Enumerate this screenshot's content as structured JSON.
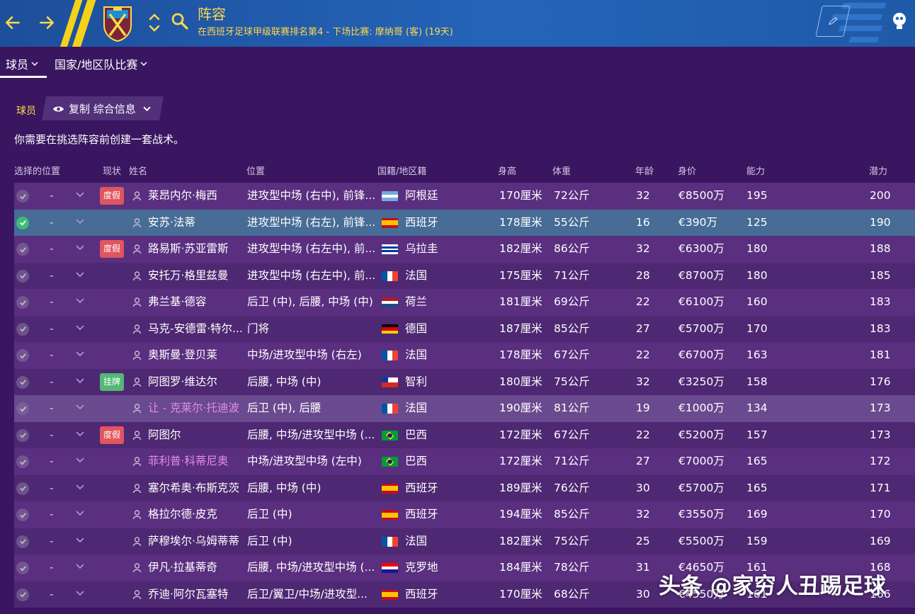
{
  "header": {
    "title": "阵容",
    "subtitle": "在西班牙足球甲级联赛排名第4 - 下场比赛: 摩纳哥 (客) (19天)"
  },
  "tabs": [
    {
      "label": "球员"
    },
    {
      "label": "国家/地区队比赛"
    }
  ],
  "toolbar": {
    "players_label": "球员",
    "view_label": "复制 综合信息"
  },
  "notice": "你需要在挑选阵容前创建一套战术。",
  "columns": {
    "selection": "选择的位置",
    "status": "现状",
    "name": "姓名",
    "position": "位置",
    "nationality": "国籍/地区籍",
    "height": "身高",
    "weight": "体重",
    "age": "年龄",
    "value": "身价",
    "ability": "能力",
    "potential": "潜力"
  },
  "rows": [
    {
      "selected": false,
      "sel_pos": "-",
      "status": "度假",
      "status_type": "inj",
      "name": "莱昂内尔·梅西",
      "position": "进攻型中场 (右中), 前锋...",
      "flag": "ar",
      "nation": "阿根廷",
      "height": "170厘米",
      "weight": "72公斤",
      "age": "32",
      "value": "€8500万",
      "ability": "195",
      "potential": "200",
      "style": "odd"
    },
    {
      "selected": true,
      "sel_pos": "-",
      "status": "",
      "status_type": "",
      "name": "安苏·法蒂",
      "position": "进攻型中场 (右左), 前锋...",
      "flag": "es",
      "nation": "西班牙",
      "height": "178厘米",
      "weight": "55公斤",
      "age": "16",
      "value": "€390万",
      "ability": "125",
      "potential": "190",
      "style": "sel"
    },
    {
      "selected": false,
      "sel_pos": "-",
      "status": "度假",
      "status_type": "inj",
      "name": "路易斯·苏亚雷斯",
      "position": "进攻型中场 (右左中), 前...",
      "flag": "uy",
      "nation": "乌拉圭",
      "height": "182厘米",
      "weight": "86公斤",
      "age": "32",
      "value": "€6300万",
      "ability": "180",
      "potential": "188",
      "style": "odd"
    },
    {
      "selected": false,
      "sel_pos": "-",
      "status": "",
      "status_type": "",
      "name": "安托万·格里兹曼",
      "position": "进攻型中场 (右左中), 前...",
      "flag": "fr",
      "nation": "法国",
      "height": "175厘米",
      "weight": "71公斤",
      "age": "28",
      "value": "€8700万",
      "ability": "180",
      "potential": "185",
      "style": "even"
    },
    {
      "selected": false,
      "sel_pos": "-",
      "status": "",
      "status_type": "",
      "name": "弗兰基·德容",
      "position": "后卫 (中), 后腰, 中场 (中)",
      "flag": "nl",
      "nation": "荷兰",
      "height": "181厘米",
      "weight": "69公斤",
      "age": "22",
      "value": "€6100万",
      "ability": "160",
      "potential": "183",
      "style": "odd"
    },
    {
      "selected": false,
      "sel_pos": "-",
      "status": "",
      "status_type": "",
      "name": "马克-安德雷·特尔...",
      "position": "门将",
      "flag": "de",
      "nation": "德国",
      "height": "187厘米",
      "weight": "85公斤",
      "age": "27",
      "value": "€5700万",
      "ability": "170",
      "potential": "183",
      "style": "even"
    },
    {
      "selected": false,
      "sel_pos": "-",
      "status": "",
      "status_type": "",
      "name": "奥斯曼·登贝莱",
      "position": "中场/进攻型中场 (右左)",
      "flag": "fr",
      "nation": "法国",
      "height": "178厘米",
      "weight": "67公斤",
      "age": "22",
      "value": "€6700万",
      "ability": "163",
      "potential": "181",
      "style": "odd"
    },
    {
      "selected": false,
      "sel_pos": "-",
      "status": "挂牌",
      "status_type": "list",
      "name": "阿图罗·维达尔",
      "position": "后腰, 中场 (中)",
      "flag": "cl",
      "nation": "智利",
      "height": "180厘米",
      "weight": "75公斤",
      "age": "32",
      "value": "€3250万",
      "ability": "158",
      "potential": "176",
      "style": "even"
    },
    {
      "selected": false,
      "sel_pos": "-",
      "status": "",
      "status_type": "",
      "name": "让 - 克莱尔·托迪波",
      "name_pink": true,
      "position": "后卫 (中), 后腰",
      "flag": "fr",
      "nation": "法国",
      "height": "190厘米",
      "weight": "81公斤",
      "age": "19",
      "value": "€1000万",
      "ability": "134",
      "potential": "173",
      "style": "lilac"
    },
    {
      "selected": false,
      "sel_pos": "-",
      "status": "度假",
      "status_type": "inj",
      "name": "阿图尔",
      "position": "后腰, 中场/进攻型中场 (...",
      "flag": "br",
      "nation": "巴西",
      "height": "172厘米",
      "weight": "67公斤",
      "age": "22",
      "value": "€5200万",
      "ability": "157",
      "potential": "173",
      "style": "even"
    },
    {
      "selected": false,
      "sel_pos": "-",
      "status": "",
      "status_type": "",
      "name": "菲利普·科蒂尼奥",
      "name_pink": true,
      "position": "中场/进攻型中场 (左中)",
      "flag": "br",
      "nation": "巴西",
      "height": "172厘米",
      "weight": "71公斤",
      "age": "27",
      "value": "€7000万",
      "ability": "165",
      "potential": "172",
      "style": "odd"
    },
    {
      "selected": false,
      "sel_pos": "-",
      "status": "",
      "status_type": "",
      "name": "塞尔希奥·布斯克茨",
      "position": "后腰, 中场 (中)",
      "flag": "es",
      "nation": "西班牙",
      "height": "189厘米",
      "weight": "76公斤",
      "age": "30",
      "value": "€5700万",
      "ability": "165",
      "potential": "171",
      "style": "even"
    },
    {
      "selected": false,
      "sel_pos": "-",
      "status": "",
      "status_type": "",
      "name": "格拉尔德·皮克",
      "position": "后卫 (中)",
      "flag": "es",
      "nation": "西班牙",
      "height": "194厘米",
      "weight": "85公斤",
      "age": "32",
      "value": "€3550万",
      "ability": "169",
      "potential": "170",
      "style": "odd"
    },
    {
      "selected": false,
      "sel_pos": "-",
      "status": "",
      "status_type": "",
      "name": "萨穆埃尔·乌姆蒂蒂",
      "position": "后卫 (中)",
      "flag": "fr",
      "nation": "法国",
      "height": "182厘米",
      "weight": "75公斤",
      "age": "25",
      "value": "€5500万",
      "ability": "159",
      "potential": "169",
      "style": "even"
    },
    {
      "selected": false,
      "sel_pos": "-",
      "status": "",
      "status_type": "",
      "name": "伊凡·拉基蒂奇",
      "position": "后腰, 中场/进攻型中场 (...",
      "flag": "hr",
      "nation": "克罗地",
      "height": "184厘米",
      "weight": "78公斤",
      "age": "31",
      "value": "€4650万",
      "ability": "161",
      "potential": "168",
      "style": "odd"
    },
    {
      "selected": false,
      "sel_pos": "-",
      "status": "",
      "status_type": "",
      "name": "乔迪·阿尔瓦塞特",
      "position": "后卫/翼卫/中场/进攻型...",
      "flag": "es",
      "nation": "西班牙",
      "height": "170厘米",
      "weight": "68公斤",
      "age": "30",
      "value": "€4550万",
      "ability": "161",
      "potential": "166",
      "style": "even"
    }
  ],
  "colors": {
    "accent": "#ffd84a",
    "header_bg": "#2464b8",
    "page_bg": "#3a1660",
    "injury_badge": "#e0555e",
    "listed_badge": "#53b876",
    "selected_row": "#476c95"
  },
  "icons": [
    "back-arrow-icon",
    "forward-arrow-icon",
    "club-crest-icon",
    "up-down-icon",
    "search-icon",
    "eye-icon",
    "chevron-down-icon",
    "person-icon",
    "check-icon",
    "pencil-icon",
    "avatar-icon"
  ],
  "watermark": "头条 @家穷人丑踢足球"
}
